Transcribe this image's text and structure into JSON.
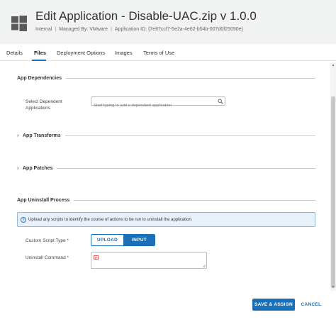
{
  "header": {
    "title": "Edit Application - Disable-UAC.zip v 1.0.0",
    "internal": "Internal",
    "managed_by": "Managed By: VMware",
    "application_id": "Application ID: {7e87ccf7-5e2a-4e62-b54b-007d0f25090e}",
    "icon": "windows-logo-icon"
  },
  "tabs": [
    {
      "label": "Details",
      "active": false
    },
    {
      "label": "Files",
      "active": true
    },
    {
      "label": "Deployment Options",
      "active": false
    },
    {
      "label": "Images",
      "active": false
    },
    {
      "label": "Terms of Use",
      "active": false
    }
  ],
  "sections": {
    "dependencies": {
      "heading": "App Dependencies",
      "field_label": "Select Dependent Applications",
      "search_placeholder": "Start typing to add a dependent application"
    },
    "transforms": {
      "heading": "App Transforms",
      "collapsed": true
    },
    "patches": {
      "heading": "App Patches",
      "collapsed": true
    },
    "uninstall": {
      "heading": "App Uninstall Process",
      "info_text": "Upload any scripts to identify the course of actions to be run to uninstall the application.",
      "script_type_label": "Custom Script Type",
      "script_type_options": [
        "UPLOAD",
        "INPUT"
      ],
      "script_type_selected": "INPUT",
      "command_label": "Uninstall Command",
      "required_marker": "*"
    }
  },
  "footer": {
    "save_label": "SAVE & ASSIGN",
    "cancel_label": "CANCEL"
  },
  "colors": {
    "accent": "#1a70b8",
    "header_bg": "#f1f2f2",
    "info_bg": "#e8f1fa",
    "required": "#dd2222"
  }
}
